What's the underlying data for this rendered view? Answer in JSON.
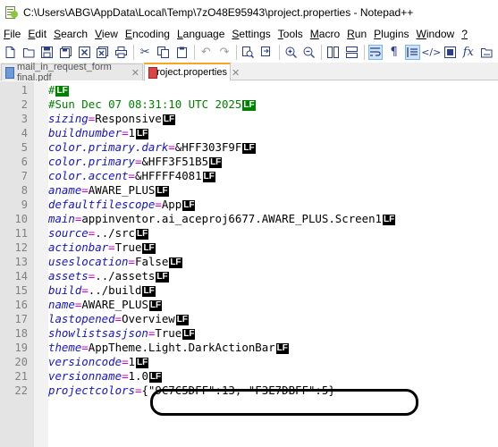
{
  "window": {
    "title": "C:\\Users\\ABG\\AppData\\Local\\Temp\\7zO48E95943\\project.properties - Notepad++"
  },
  "menu": [
    {
      "u": "F",
      "rest": "ile"
    },
    {
      "u": "E",
      "rest": "dit"
    },
    {
      "u": "S",
      "rest": "earch"
    },
    {
      "u": "V",
      "rest": "iew"
    },
    {
      "u": "E",
      "rest": "ncoding",
      "pre": ""
    },
    {
      "u": "L",
      "rest": "anguage"
    },
    {
      "u": "S",
      "rest": "e",
      "label": "Settings"
    },
    {
      "u": "T",
      "rest": "ools"
    },
    {
      "u": "M",
      "rest": "acro"
    },
    {
      "u": "R",
      "rest": "un"
    },
    {
      "u": "P",
      "rest": "lugins"
    },
    {
      "u": "W",
      "rest": "indow"
    },
    {
      "u": "?",
      "rest": ""
    }
  ],
  "menu_labels": [
    "File",
    "Edit",
    "Search",
    "View",
    "Encoding",
    "Language",
    "Settings",
    "Tools",
    "Macro",
    "Run",
    "Plugins",
    "Window",
    "?"
  ],
  "toolbar": {
    "icons": [
      "new-file-icon",
      "open-file-icon",
      "save-icon",
      "save-all-icon",
      "close-icon",
      "close-all-icon",
      "print-icon",
      "cut-icon",
      "copy-icon",
      "paste-icon",
      "undo-icon",
      "redo-icon",
      "find-icon",
      "replace-icon",
      "zoom-in-icon",
      "zoom-out-icon",
      "sync-vertical-icon",
      "sync-horizontal-icon",
      "word-wrap-icon",
      "show-all-characters-icon",
      "indent-guide-icon",
      "xml-tags-icon",
      "document-map-icon",
      "function-list-icon",
      "folder-workspace-icon"
    ]
  },
  "tabs": [
    {
      "label": "mail_in_request_form final.pdf",
      "active": false
    },
    {
      "label": "project.properties",
      "active": true
    }
  ],
  "editor": {
    "lines": [
      {
        "n": "1",
        "comment": "#",
        "lf": true,
        "green": true
      },
      {
        "n": "2",
        "comment": "#Sun Dec 07 08:31:10 UTC 2025",
        "lf": true,
        "green": true
      },
      {
        "n": "3",
        "key": "sizing",
        "value": "Responsive",
        "lf": true
      },
      {
        "n": "4",
        "key": "buildnumber",
        "value": "1",
        "lf": true
      },
      {
        "n": "5",
        "key": "color.primary.dark",
        "value": "&HFF303F9F",
        "lf": true
      },
      {
        "n": "6",
        "key": "color.primary",
        "value": "&HFF3F51B5",
        "lf": true
      },
      {
        "n": "7",
        "key": "color.accent",
        "value": "&HFFFF4081",
        "lf": true
      },
      {
        "n": "8",
        "key": "aname",
        "value": "AWARE_PLUS",
        "lf": true
      },
      {
        "n": "9",
        "key": "defaultfilescope",
        "value": "App",
        "lf": true
      },
      {
        "n": "10",
        "key": "main",
        "value": "appinventor.ai_aceproj6677.AWARE_PLUS.Screen1",
        "lf": true
      },
      {
        "n": "11",
        "key": "source",
        "value": "../src",
        "lf": true
      },
      {
        "n": "12",
        "key": "actionbar",
        "value": "True",
        "lf": true
      },
      {
        "n": "13",
        "key": "useslocation",
        "value": "False",
        "lf": true
      },
      {
        "n": "14",
        "key": "assets",
        "value": "../assets",
        "lf": true
      },
      {
        "n": "15",
        "key": "build",
        "value": "../build",
        "lf": true
      },
      {
        "n": "16",
        "key": "name",
        "value": "AWARE_PLUS",
        "lf": true
      },
      {
        "n": "17",
        "key": "lastopened",
        "value": "Overview",
        "lf": true
      },
      {
        "n": "18",
        "key": "showlistsasjson",
        "value": "True",
        "lf": true
      },
      {
        "n": "19",
        "key": "theme",
        "value": "AppTheme.Light.DarkActionBar",
        "lf": true
      },
      {
        "n": "20",
        "key": "versioncode",
        "value": "1",
        "lf": true
      },
      {
        "n": "21",
        "key": "versionname",
        "value": "1.0",
        "lf": true
      },
      {
        "n": "22",
        "key": "projectcolors",
        "value": "{\"9C7C5DFF\":13, \"F3E7DBFF\":5}",
        "lf": false
      }
    ],
    "lf_label": "LF"
  },
  "colors": {
    "key": "#1414c8",
    "equals": "#d100d1",
    "comment": "#008000",
    "line_number": "#808080",
    "active_tab_accent": "#f5a623"
  }
}
